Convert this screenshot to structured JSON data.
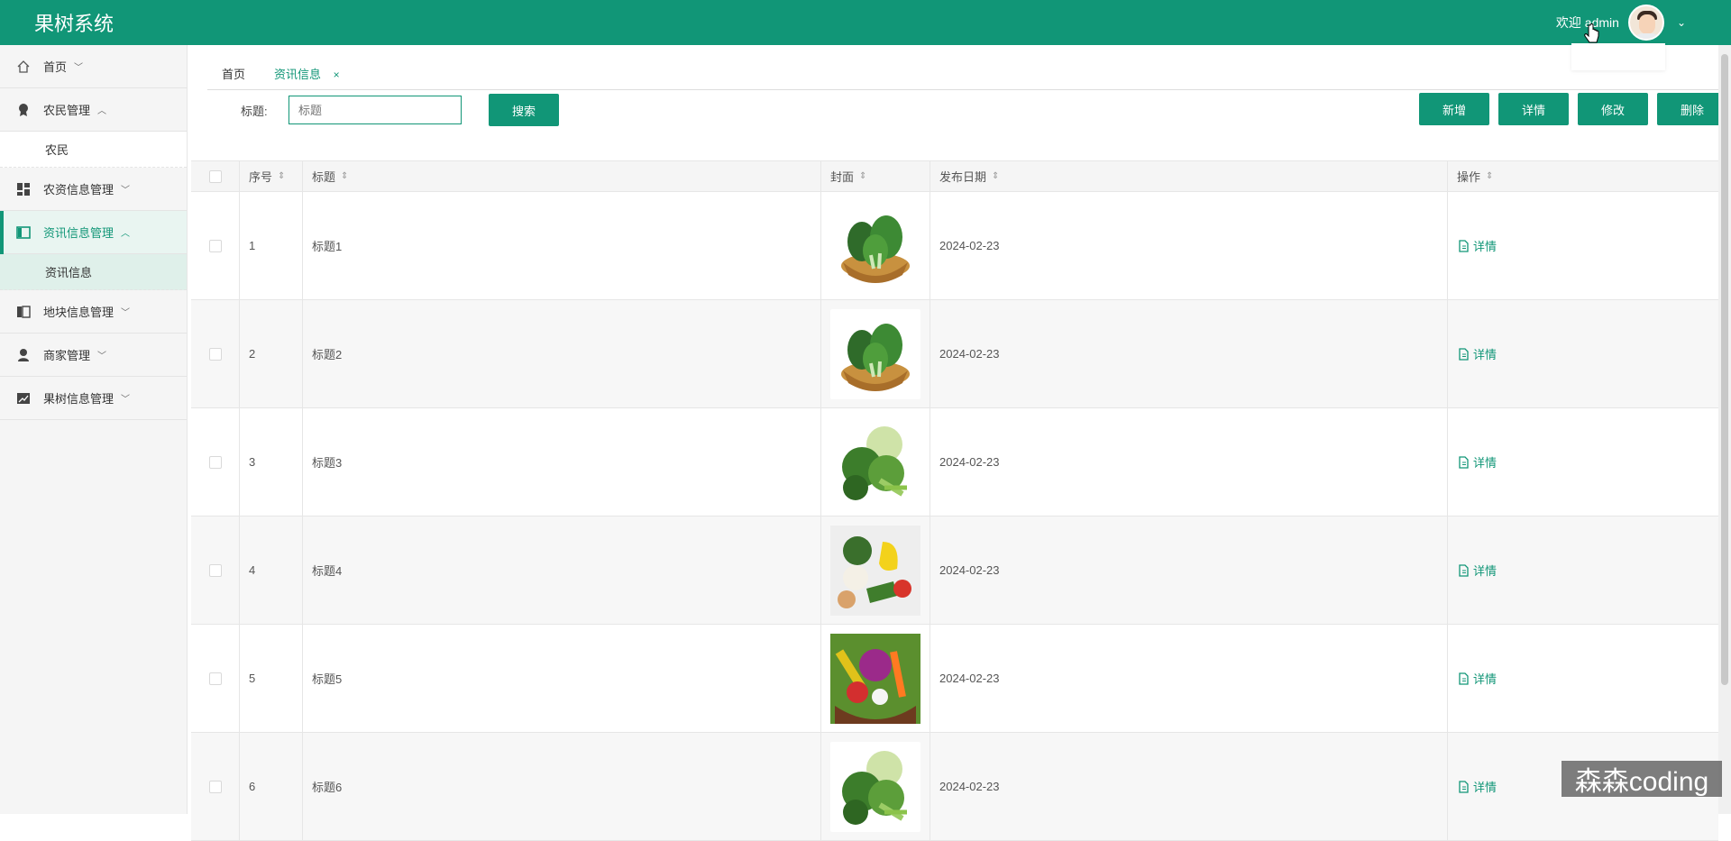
{
  "app": {
    "title": "果树系统"
  },
  "header": {
    "welcome": "欢迎 admin"
  },
  "sidebar": {
    "items": [
      {
        "label": "首页",
        "icon": "home-icon",
        "arrow": "﹀"
      },
      {
        "label": "农民管理",
        "icon": "badge-icon",
        "arrow": "︿",
        "sub": [
          {
            "label": "农民"
          }
        ]
      },
      {
        "label": "农资信息管理",
        "icon": "dashboard-icon",
        "arrow": "﹀"
      },
      {
        "label": "资讯信息管理",
        "icon": "panel-icon",
        "arrow": "︿",
        "sub": [
          {
            "label": "资讯信息"
          }
        ]
      },
      {
        "label": "地块信息管理",
        "icon": "columns-icon",
        "arrow": "﹀"
      },
      {
        "label": "商家管理",
        "icon": "user-icon",
        "arrow": "﹀"
      },
      {
        "label": "果树信息管理",
        "icon": "chart-icon",
        "arrow": "﹀"
      }
    ]
  },
  "tabs": [
    {
      "label": "首页"
    },
    {
      "label": "资讯信息",
      "close": "×"
    }
  ],
  "search": {
    "label": "标题:",
    "placeholder": "标题",
    "button": "搜索"
  },
  "actions": {
    "add": "新增",
    "detail": "详情",
    "edit": "修改",
    "delete": "删除"
  },
  "table": {
    "headers": [
      "序号",
      "标题",
      "封面",
      "发布日期",
      "操作"
    ],
    "sort_icon": "⇕",
    "rows": [
      {
        "no": "1",
        "title": "标题1",
        "date": "2024-02-23",
        "action": "详情",
        "cover": "bok-choy-basket"
      },
      {
        "no": "2",
        "title": "标题2",
        "date": "2024-02-23",
        "action": "详情",
        "cover": "bok-choy-basket"
      },
      {
        "no": "3",
        "title": "标题3",
        "date": "2024-02-23",
        "action": "详情",
        "cover": "mixed-greens"
      },
      {
        "no": "4",
        "title": "标题4",
        "date": "2024-02-23",
        "action": "详情",
        "cover": "assorted-vegetables"
      },
      {
        "no": "5",
        "title": "标题5",
        "date": "2024-02-23",
        "action": "详情",
        "cover": "vegetable-basket"
      },
      {
        "no": "6",
        "title": "标题6",
        "date": "2024-02-23",
        "action": "详情",
        "cover": "mixed-greens"
      }
    ]
  },
  "watermark": {
    "text": "森森coding"
  },
  "colors": {
    "primary": "#119677",
    "sidebar_bg": "#f5f5f5",
    "header_bg": "#119677"
  }
}
